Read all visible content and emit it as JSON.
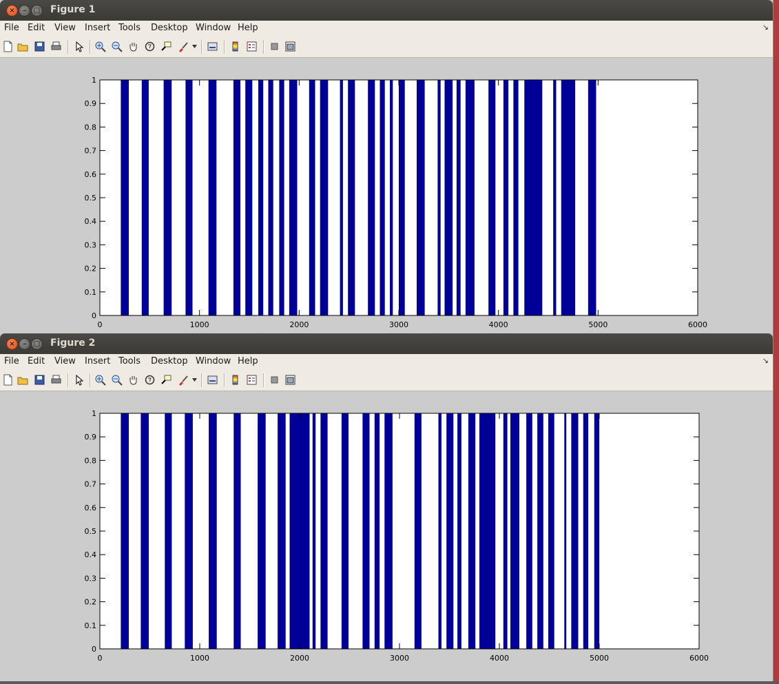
{
  "figures": [
    {
      "title": "Figure 1",
      "menu": [
        "File",
        "Edit",
        "View",
        "Insert",
        "Tools",
        "Desktop",
        "Window",
        "Help"
      ],
      "chart_data": {
        "type": "bar",
        "xlim": [
          0,
          6000
        ],
        "ylim": [
          0,
          1
        ],
        "xticks": [
          "0",
          "1000",
          "2000",
          "3000",
          "4000",
          "5000",
          "6000"
        ],
        "yticks": [
          "0",
          "0.1",
          "0.2",
          "0.3",
          "0.4",
          "0.5",
          "0.6",
          "0.7",
          "0.8",
          "0.9",
          "1"
        ],
        "bar_value": 1,
        "bars_x_ranges": [
          [
            210,
            290
          ],
          [
            420,
            490
          ],
          [
            640,
            720
          ],
          [
            860,
            930
          ],
          [
            1090,
            1170
          ],
          [
            1340,
            1410
          ],
          [
            1460,
            1530
          ],
          [
            1590,
            1640
          ],
          [
            1690,
            1740
          ],
          [
            1800,
            1850
          ],
          [
            1900,
            1980
          ],
          [
            2100,
            2160
          ],
          [
            2210,
            2290
          ],
          [
            2410,
            2440
          ],
          [
            2490,
            2560
          ],
          [
            2690,
            2760
          ],
          [
            2810,
            2860
          ],
          [
            2910,
            2940
          ],
          [
            3000,
            3060
          ],
          [
            3180,
            3260
          ],
          [
            3390,
            3420
          ],
          [
            3460,
            3540
          ],
          [
            3580,
            3620
          ],
          [
            3670,
            3760
          ],
          [
            3900,
            3970
          ],
          [
            4050,
            4100
          ],
          [
            4150,
            4200
          ],
          [
            4260,
            4440
          ],
          [
            4550,
            4580
          ],
          [
            4630,
            4770
          ],
          [
            4900,
            4980
          ]
        ]
      }
    },
    {
      "title": "Figure 2",
      "menu": [
        "File",
        "Edit",
        "View",
        "Insert",
        "Tools",
        "Desktop",
        "Window",
        "Help"
      ],
      "chart_data": {
        "type": "bar",
        "xlim": [
          0,
          6000
        ],
        "ylim": [
          0,
          1
        ],
        "xticks": [
          "0",
          "1000",
          "2000",
          "3000",
          "4000",
          "5000",
          "6000"
        ],
        "yticks": [
          "0",
          "0.1",
          "0.2",
          "0.3",
          "0.4",
          "0.5",
          "0.6",
          "0.7",
          "0.8",
          "0.9",
          "1"
        ],
        "bar_value": 1,
        "bars_x_ranges": [
          [
            210,
            290
          ],
          [
            410,
            490
          ],
          [
            650,
            720
          ],
          [
            850,
            930
          ],
          [
            1090,
            1170
          ],
          [
            1340,
            1410
          ],
          [
            1580,
            1660
          ],
          [
            1780,
            1860
          ],
          [
            1900,
            2100
          ],
          [
            2130,
            2160
          ],
          [
            2210,
            2280
          ],
          [
            2420,
            2490
          ],
          [
            2630,
            2700
          ],
          [
            2750,
            2800
          ],
          [
            2850,
            2930
          ],
          [
            3150,
            3220
          ],
          [
            3390,
            3420
          ],
          [
            3470,
            3540
          ],
          [
            3580,
            3620
          ],
          [
            3690,
            3760
          ],
          [
            3800,
            3960
          ],
          [
            4040,
            4080
          ],
          [
            4110,
            4200
          ],
          [
            4270,
            4330
          ],
          [
            4380,
            4440
          ],
          [
            4490,
            4550
          ],
          [
            4650,
            4670
          ],
          [
            4720,
            4790
          ],
          [
            4840,
            4890
          ],
          [
            4950,
            5000
          ]
        ]
      }
    }
  ]
}
